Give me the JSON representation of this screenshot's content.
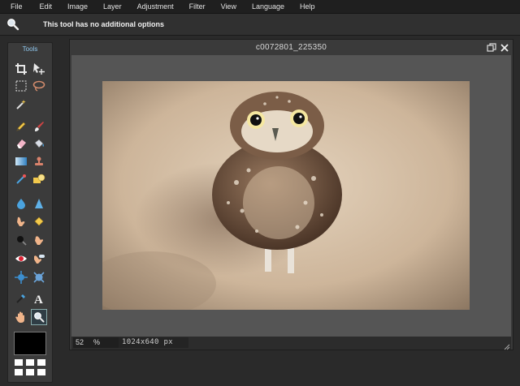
{
  "menubar": {
    "items": [
      "File",
      "Edit",
      "Image",
      "Layer",
      "Adjustment",
      "Filter",
      "View",
      "Language",
      "Help"
    ]
  },
  "options": {
    "text": "This tool has no additional options",
    "icon": "zoom-icon"
  },
  "tools": {
    "title": "Tools",
    "items": [
      "crop-icon",
      "move-icon",
      "marquee-select-icon",
      "lasso-icon",
      "magic-wand-icon",
      "pencil-icon",
      "brush-icon",
      "eraser-icon",
      "paint-bucket-icon",
      "gradient-icon",
      "clone-stamp-icon",
      "color-replace-icon",
      "drawing-icon",
      "blur-icon",
      "sharpen-icon",
      "smudge-icon",
      "sponge-icon",
      "dodge-icon",
      "burn-icon",
      "red-eye-icon",
      "spot-heal-icon",
      "bloat-icon",
      "pinch-icon",
      "color-picker-icon",
      "type-icon",
      "hand-icon",
      "zoom-icon"
    ],
    "selected": "zoom-icon",
    "foreground_color": "#000000"
  },
  "window": {
    "title": "c0072801_225350",
    "zoom": "52",
    "zoom_unit": "%",
    "dimensions": "1024x640 px"
  }
}
